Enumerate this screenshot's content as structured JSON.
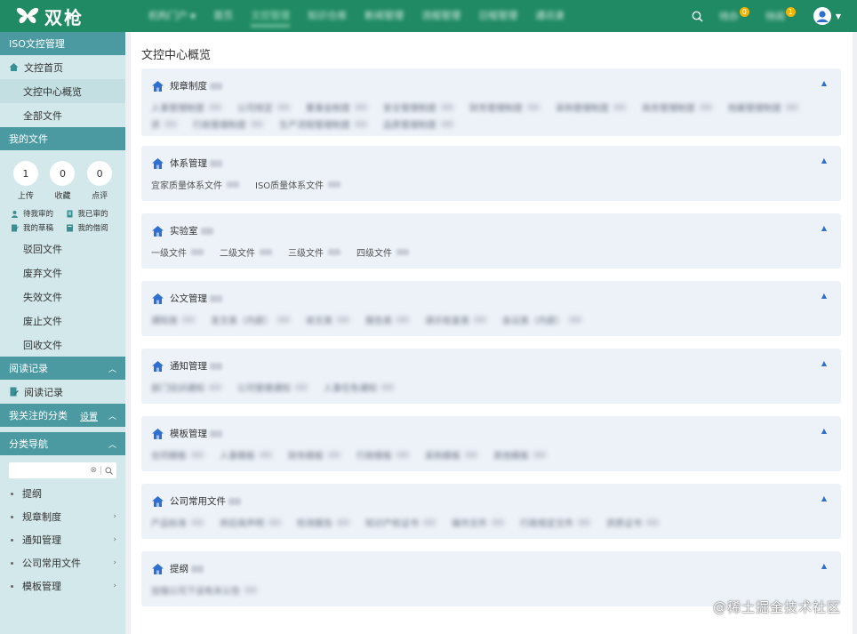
{
  "app": {
    "logo_text": "双枪",
    "nav": [
      {
        "label": "机构门户",
        "dropdown": true,
        "blurred": true
      },
      {
        "label": "首页",
        "blurred": true
      },
      {
        "label": "文控管理",
        "active": true,
        "blurred": true
      },
      {
        "label": "知识仓库",
        "blurred": true
      },
      {
        "label": "新闻管理",
        "blurred": true
      },
      {
        "label": "流程管理",
        "blurred": true
      },
      {
        "label": "日程管理",
        "blurred": true
      },
      {
        "label": "通讯录",
        "blurred": true
      }
    ],
    "top_right": {
      "todo_label": "待办",
      "todo_count": "0",
      "pending_label": "待阅",
      "pending_count": "1"
    }
  },
  "sidebar": {
    "section_iso": "ISO文控管理",
    "iso_items": [
      "文控首页",
      "文控中心概览",
      "全部文件"
    ],
    "section_myfiles": "我的文件",
    "stats": [
      {
        "value": "1",
        "label": "上传"
      },
      {
        "value": "0",
        "label": "收藏"
      },
      {
        "value": "0",
        "label": "点评"
      }
    ],
    "quick": [
      "待我审的",
      "我已审的",
      "我的草稿",
      "我的借阅"
    ],
    "file_items": [
      "驳回文件",
      "废弃文件",
      "失效文件",
      "废止文件",
      "回收文件"
    ],
    "section_read": "阅读记录",
    "read_item": "阅读记录",
    "section_follow": "我关注的分类",
    "follow_setting": "设置",
    "section_nav": "分类导航",
    "categories": [
      "提纲",
      "规章制度",
      "通知管理",
      "公司常用文件",
      "模板管理"
    ]
  },
  "main": {
    "title": "文控中心概览",
    "cards": [
      {
        "name": "规章制度",
        "docs": [
          {
            "label": "人事管理制度",
            "blur": true
          },
          {
            "label": "公司规定",
            "blur": true
          },
          {
            "label": "董事会制度",
            "blur": true
          },
          {
            "label": "安全管理制度",
            "blur": true
          },
          {
            "label": "财务管理制度",
            "blur": true
          },
          {
            "label": "采购管理制度",
            "blur": true
          },
          {
            "label": "商务管理制度",
            "blur": true
          },
          {
            "label": "档案管理制度",
            "blur": true
          },
          {
            "label": "资",
            "blur": true
          },
          {
            "label": "行政管理制度",
            "blur": true
          },
          {
            "label": "生产流程管理制度",
            "blur": true
          },
          {
            "label": "品质管理制度",
            "blur": true
          }
        ]
      },
      {
        "name": "体系管理",
        "docs": [
          {
            "label": "宜家质量体系文件",
            "blur": false
          },
          {
            "label": "ISO质量体系文件",
            "blur": false
          }
        ]
      },
      {
        "name": "实验室",
        "docs": [
          {
            "label": "一级文件",
            "blur": false
          },
          {
            "label": "二级文件",
            "blur": false
          },
          {
            "label": "三级文件",
            "blur": false
          },
          {
            "label": "四级文件",
            "blur": false
          }
        ]
      },
      {
        "name": "公文管理",
        "docs": [
          {
            "label": "通知类",
            "blur": true
          },
          {
            "label": "发文类（内部）",
            "blur": true
          },
          {
            "label": "收文类",
            "blur": true
          },
          {
            "label": "报告类",
            "blur": true
          },
          {
            "label": "请示批复类",
            "blur": true
          },
          {
            "label": "会议类（内部）",
            "blur": true
          }
        ]
      },
      {
        "name": "通知管理",
        "docs": [
          {
            "label": "部门培训通知",
            "blur": true
          },
          {
            "label": "公司管理通知",
            "blur": true
          },
          {
            "label": "人事任免通知",
            "blur": true
          }
        ]
      },
      {
        "name": "模板管理",
        "docs": [
          {
            "label": "合同模板",
            "blur": true
          },
          {
            "label": "人事模板",
            "blur": true
          },
          {
            "label": "财务模板",
            "blur": true
          },
          {
            "label": "行政模板",
            "blur": true
          },
          {
            "label": "采购模板",
            "blur": true
          },
          {
            "label": "其他模板",
            "blur": true
          }
        ]
      },
      {
        "name": "公司常用文件",
        "docs": [
          {
            "label": "产品标准",
            "blur": true
          },
          {
            "label": "供应商声明",
            "blur": true
          },
          {
            "label": "检测报告",
            "blur": true
          },
          {
            "label": "知识产权证书",
            "blur": true
          },
          {
            "label": "操作文件",
            "blur": true
          },
          {
            "label": "行政规定文件",
            "blur": true
          },
          {
            "label": "资质证书",
            "blur": true
          }
        ]
      },
      {
        "name": "提纲",
        "docs": [
          {
            "label": "加强公司下设有关公告",
            "blur": true
          }
        ]
      }
    ]
  },
  "watermark": "@稀土掘金技术社区",
  "colors": {
    "header": "#1f8a63",
    "sidebar_section": "#4b9aa1",
    "sidebar_bg": "#d3e8ea",
    "card_bg": "#edf2f9",
    "badge": "#f0b400",
    "accent_blue": "#2f6fd0"
  }
}
